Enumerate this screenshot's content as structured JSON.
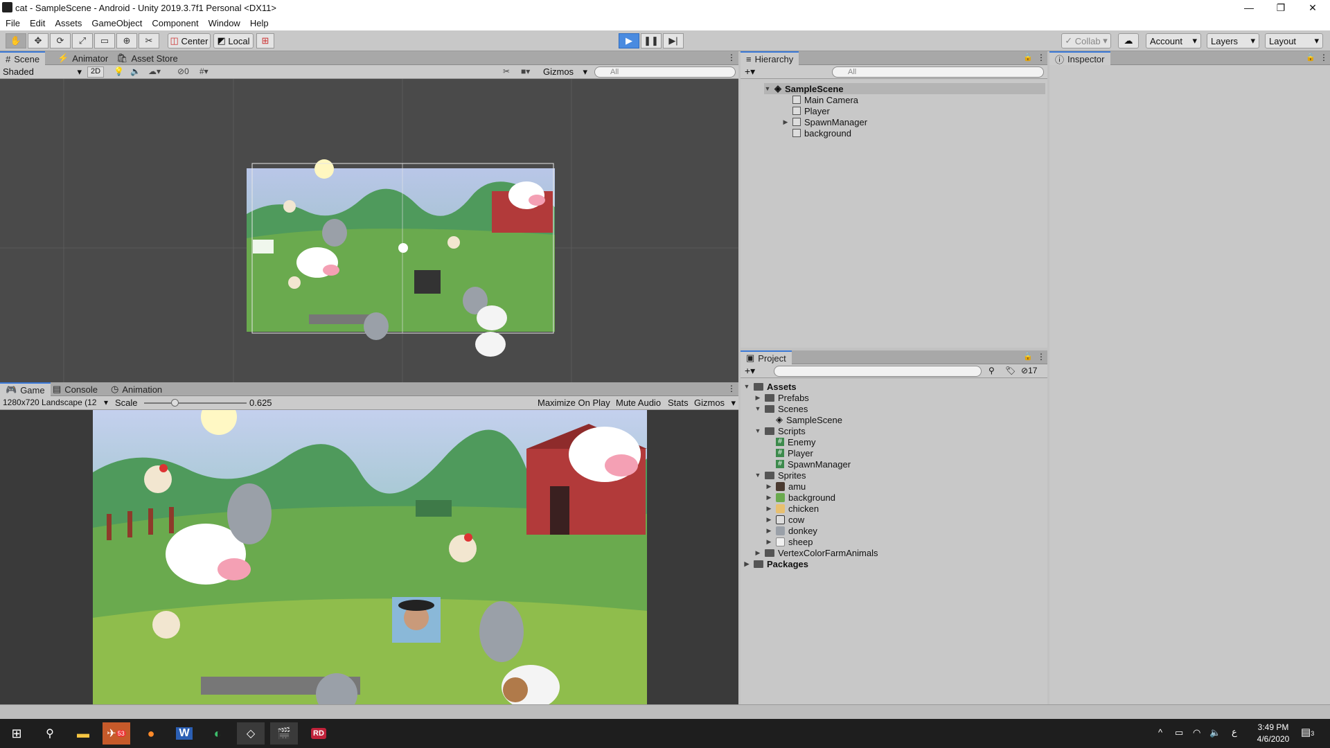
{
  "window": {
    "title": "cat - SampleScene - Android - Unity 2019.3.7f1 Personal <DX11>",
    "min": "—",
    "max": "❐",
    "close": "✕"
  },
  "menu": [
    "File",
    "Edit",
    "Assets",
    "GameObject",
    "Component",
    "Window",
    "Help"
  ],
  "toolbar": {
    "pivot": "Center",
    "space": "Local",
    "collab": "Collab",
    "account": "Account",
    "layers": "Layers",
    "layout": "Layout"
  },
  "scene": {
    "tabs": [
      "Scene",
      "Animator",
      "Asset Store"
    ],
    "shading": "Shaded",
    "mode2d": "2D",
    "hidden_count": "0",
    "gizmos": "Gizmos",
    "search_placeholder": "All"
  },
  "game": {
    "tabs": [
      "Game",
      "Console",
      "Animation"
    ],
    "resolution": "1280x720 Landscape (12",
    "scale_label": "Scale",
    "scale_value": "0.625",
    "scale_fraction": 0.3,
    "maximize": "Maximize On Play",
    "mute": "Mute Audio",
    "stats": "Stats",
    "gizmos": "Gizmos"
  },
  "hierarchy": {
    "title": "Hierarchy",
    "search_placeholder": "All",
    "scene": "SampleScene",
    "items": [
      "Main Camera",
      "Player",
      "SpawnManager",
      "background"
    ]
  },
  "inspector": {
    "title": "Inspector"
  },
  "project": {
    "title": "Project",
    "count": "17",
    "root": "Assets",
    "folders": {
      "prefabs": "Prefabs",
      "scenes": "Scenes",
      "scripts": "Scripts",
      "sprites": "Sprites",
      "vertex": "VertexColorFarmAnimals"
    },
    "scene_file": "SampleScene",
    "scripts": [
      "Enemy",
      "Player",
      "SpawnManager"
    ],
    "sprites": [
      "amu",
      "background",
      "chicken",
      "cow",
      "donkey",
      "sheep"
    ],
    "packages": "Packages"
  },
  "taskbar": {
    "time": "3:49 PM",
    "date": "4/6/2020",
    "badge": "53",
    "notif": "3",
    "lang": "ع"
  }
}
